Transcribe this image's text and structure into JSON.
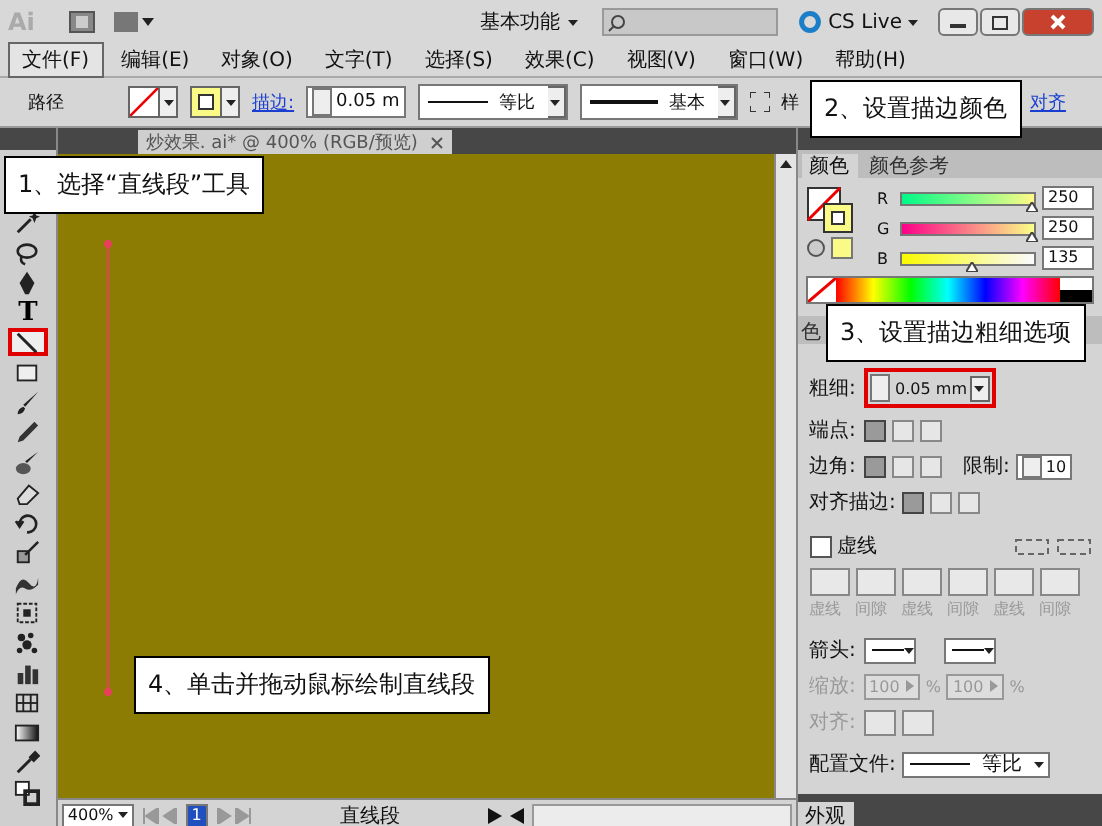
{
  "title_bar": {
    "app_logo": "Ai",
    "workspace": "基本功能",
    "cs_live": "CS Live"
  },
  "menu": [
    {
      "label": "文件(F)",
      "selected": true
    },
    {
      "label": "编辑(E)",
      "selected": false
    },
    {
      "label": "对象(O)",
      "selected": false
    },
    {
      "label": "文字(T)",
      "selected": false
    },
    {
      "label": "选择(S)",
      "selected": false
    },
    {
      "label": "效果(C)",
      "selected": false
    },
    {
      "label": "视图(V)",
      "selected": false
    },
    {
      "label": "窗口(W)",
      "selected": false
    },
    {
      "label": "帮助(H)",
      "selected": false
    }
  ],
  "control_bar": {
    "object_type": "路径",
    "stroke_label": "描边:",
    "stroke_weight": "0.05 m",
    "profile": "等比",
    "brush": "基本",
    "style_label": "样",
    "align_link": "对齐"
  },
  "document_tab": {
    "title": "炒效果. ai* @ 400% (RGB/预览)"
  },
  "tools": [
    {
      "kind": "wand",
      "selected": false
    },
    {
      "kind": "lasso",
      "selected": false
    },
    {
      "kind": "pen",
      "selected": false
    },
    {
      "kind": "type",
      "glyph": "T",
      "selected": false
    },
    {
      "kind": "line",
      "selected": true
    },
    {
      "kind": "rect",
      "selected": false
    },
    {
      "kind": "brush",
      "selected": false
    },
    {
      "kind": "pencil",
      "selected": false
    },
    {
      "kind": "blob",
      "selected": false
    },
    {
      "kind": "eraser",
      "selected": false
    },
    {
      "kind": "rotate",
      "selected": false
    },
    {
      "kind": "scale",
      "selected": false
    },
    {
      "kind": "warp",
      "selected": false
    },
    {
      "kind": "transform",
      "selected": false
    },
    {
      "kind": "spray",
      "selected": false
    },
    {
      "kind": "graph",
      "selected": false
    },
    {
      "kind": "grid",
      "selected": false
    },
    {
      "kind": "gradient",
      "selected": false
    },
    {
      "kind": "eyedropper",
      "selected": false
    },
    {
      "kind": "swap",
      "selected": false
    }
  ],
  "color_panel": {
    "tabs": [
      {
        "label": "颜色",
        "selected": true
      },
      {
        "label": "颜色参考",
        "selected": false
      }
    ],
    "channels": [
      {
        "name": "R",
        "level": 0.98,
        "value": "250"
      },
      {
        "name": "G",
        "level": 0.98,
        "value": "250"
      },
      {
        "name": "B",
        "level": 0.53,
        "value": "135"
      }
    ]
  },
  "panel_tabs": [
    {
      "label": "色"
    }
  ],
  "stroke_panel": {
    "weight_label": "粗细:",
    "weight": "0.05 mm",
    "weight_highlighted": true,
    "cap_label": "端点:",
    "caps": [
      {
        "selected": true
      },
      {
        "selected": false
      },
      {
        "selected": false
      }
    ],
    "corner_label": "边角:",
    "corners": [
      {
        "selected": true
      },
      {
        "selected": false
      },
      {
        "selected": false
      }
    ],
    "limit_label": "限制:",
    "limit": "10",
    "align_label": "对齐描边:",
    "aligns": [
      {
        "selected": true
      },
      {
        "selected": false
      },
      {
        "selected": false
      }
    ],
    "dashed_label": "虚线",
    "dashed": false,
    "dash_fields": [
      {
        "label": "虚线"
      },
      {
        "label": "间隙"
      },
      {
        "label": "虚线"
      },
      {
        "label": "间隙"
      },
      {
        "label": "虚线"
      },
      {
        "label": "间隙"
      }
    ],
    "arrow_label": "箭头:",
    "scale_label": "缩放:",
    "scales": [
      {
        "value": "100",
        "unit": "%"
      },
      {
        "value": "100",
        "unit": "%"
      }
    ],
    "scale_disabled": true,
    "arrow_align_label": "对齐:",
    "profile_label": "配置文件:",
    "profile": "等比"
  },
  "bottom_tabs": [
    {
      "label": "外观"
    }
  ],
  "status_bar": {
    "zoom": "400%",
    "page": "1",
    "tool": "直线段"
  },
  "callouts": [
    {
      "text": "1、选择“直线段”工具"
    },
    {
      "text": "2、设置描边颜色"
    },
    {
      "text": "3、设置描边粗细选项"
    },
    {
      "text": "4、单击并拖动鼠标绘制直线段"
    }
  ]
}
